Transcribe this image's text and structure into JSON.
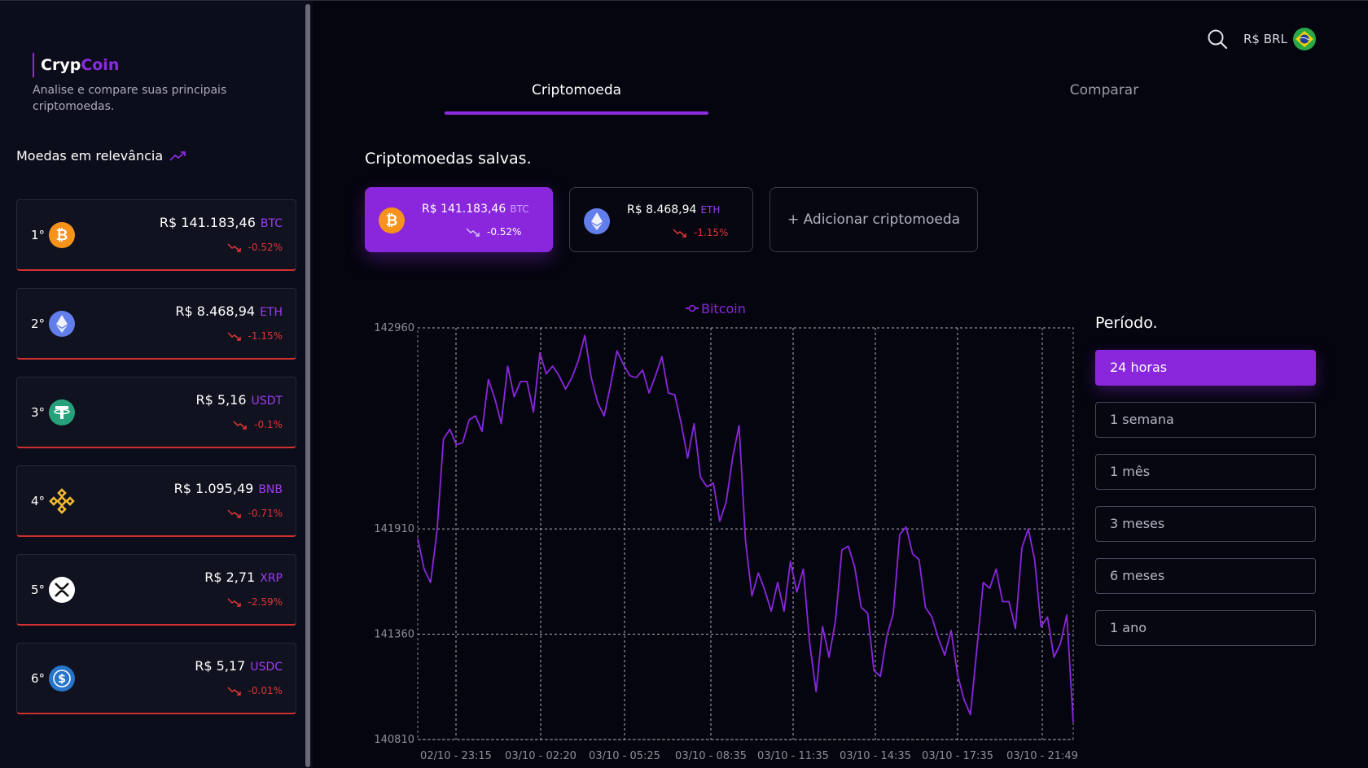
{
  "app": {
    "brand_part1": "Cryp",
    "brand_part2": "Coin",
    "tagline": "Analise e compare suas principais criptomoedas."
  },
  "sidebar": {
    "section_title": "Moedas em relevância",
    "coins": [
      {
        "rank": "1°",
        "price": "R$ 141.183,46",
        "symbol": "BTC",
        "change": "-0.52%",
        "icon": "bitcoin-icon"
      },
      {
        "rank": "2°",
        "price": "R$ 8.468,94",
        "symbol": "ETH",
        "change": "-1.15%",
        "icon": "ethereum-icon"
      },
      {
        "rank": "3°",
        "price": "R$ 5,16",
        "symbol": "USDT",
        "change": "-0.1%",
        "icon": "tether-icon"
      },
      {
        "rank": "4°",
        "price": "R$ 1.095,49",
        "symbol": "BNB",
        "change": "-0.71%",
        "icon": "bnb-icon"
      },
      {
        "rank": "5°",
        "price": "R$ 2,71",
        "symbol": "XRP",
        "change": "-2.59%",
        "icon": "xrp-icon"
      },
      {
        "rank": "6°",
        "price": "R$ 5,17",
        "symbol": "USDC",
        "change": "-0.01%",
        "icon": "usdc-icon"
      }
    ]
  },
  "header": {
    "currency": "R$ BRL"
  },
  "tabs": [
    {
      "label": "Criptomoeda",
      "active": true
    },
    {
      "label": "Comparar",
      "active": false
    }
  ],
  "saved": {
    "title": "Criptomoedas salvas.",
    "items": [
      {
        "price": "R$ 141.183,46",
        "symbol": "BTC",
        "change": "-0.52%",
        "active": true
      },
      {
        "price": "R$ 8.468,94",
        "symbol": "ETH",
        "change": "-1.15%",
        "active": false
      }
    ],
    "add_label": "+ Adicionar criptomoeda"
  },
  "period": {
    "title": "Período.",
    "options": [
      "24 horas",
      "1 semana",
      "1 mês",
      "3 meses",
      "6 meses",
      "1 ano"
    ],
    "selected": "24 horas"
  },
  "colors": {
    "accent": "#8a27dd",
    "negative": "#e03535",
    "background": "#05050f",
    "sidebar": "#0c0d1a"
  },
  "chart_data": {
    "type": "line",
    "legend": "Bitcoin",
    "y_ticks": [
      142960,
      141910,
      141360,
      140810
    ],
    "x_ticks": [
      "02/10 - 23:15",
      "03/10 - 02:20",
      "03/10 - 05:25",
      "03/10 - 08:35",
      "03/10 - 11:35",
      "03/10 - 14:35",
      "03/10 - 17:35",
      "03/10 - 21:49"
    ],
    "ylim": [
      140810,
      142960
    ],
    "grid": true,
    "series": [
      {
        "name": "Bitcoin",
        "color": "#8a27dd",
        "values": [
          141860,
          141700,
          141630,
          141900,
          142380,
          142430,
          142350,
          142360,
          142480,
          142500,
          142420,
          142690,
          142590,
          142460,
          142760,
          142600,
          142680,
          142680,
          142520,
          142830,
          142720,
          142760,
          142710,
          142640,
          142700,
          142790,
          142920,
          142700,
          142570,
          142500,
          142660,
          142840,
          142770,
          142710,
          142700,
          142740,
          142620,
          142710,
          142810,
          142620,
          142610,
          142460,
          142280,
          142460,
          142180,
          142130,
          142150,
          141950,
          142050,
          142280,
          142450,
          141850,
          141560,
          141680,
          141590,
          141480,
          141630,
          141480,
          141740,
          141580,
          141700,
          141310,
          141060,
          141400,
          141240,
          141430,
          141800,
          141820,
          141710,
          141500,
          141470,
          141170,
          141140,
          141350,
          141470,
          141880,
          141920,
          141780,
          141750,
          141500,
          141450,
          141340,
          141250,
          141380,
          141150,
          141020,
          140940,
          141280,
          141630,
          141600,
          141700,
          141530,
          141530,
          141390,
          141810,
          141910,
          141750,
          141400,
          141450,
          141240,
          141310,
          141460,
          140900
        ]
      }
    ]
  }
}
